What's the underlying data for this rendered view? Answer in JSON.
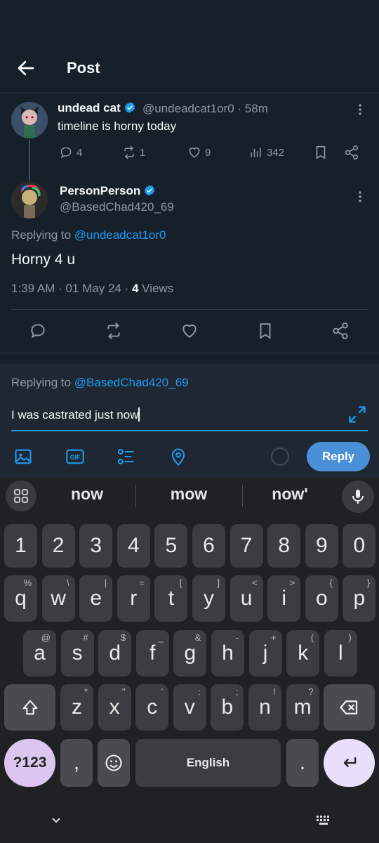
{
  "header": {
    "title": "Post"
  },
  "tweet1": {
    "name": "undead cat",
    "handle_time": "@undeadcat1or0 · 58m",
    "text": "timeline is horny today",
    "replies": "4",
    "reposts": "1",
    "likes": "9",
    "views": "342"
  },
  "tweet2": {
    "name": "PersonPerson",
    "handle": "@BasedChad420_69",
    "replying_prefix": "Replying to ",
    "replying_handle": "@undeadcat1or0",
    "text": "Horny 4 u",
    "meta_prefix": "1:39 AM · 01 May 24 · ",
    "views_count": "4",
    "views_label": " Views"
  },
  "composer": {
    "replying_prefix": "Replying to ",
    "replying_handle": "@BasedChad420_69",
    "input_value": "I was castrated just now",
    "reply_label": "Reply"
  },
  "keyboard": {
    "suggestions": [
      "now",
      "mow",
      "now'"
    ],
    "row1": [
      "1",
      "2",
      "3",
      "4",
      "5",
      "6",
      "7",
      "8",
      "9",
      "0"
    ],
    "row2": [
      {
        "k": "q",
        "s": "%"
      },
      {
        "k": "w",
        "s": "\\"
      },
      {
        "k": "e",
        "s": "|"
      },
      {
        "k": "r",
        "s": "="
      },
      {
        "k": "t",
        "s": "["
      },
      {
        "k": "y",
        "s": "]"
      },
      {
        "k": "u",
        "s": "<"
      },
      {
        "k": "i",
        "s": ">"
      },
      {
        "k": "o",
        "s": "{"
      },
      {
        "k": "p",
        "s": "}"
      }
    ],
    "row3": [
      {
        "k": "a",
        "s": "@"
      },
      {
        "k": "s",
        "s": "#"
      },
      {
        "k": "d",
        "s": "$"
      },
      {
        "k": "f",
        "s": "_"
      },
      {
        "k": "g",
        "s": "&"
      },
      {
        "k": "h",
        "s": "-"
      },
      {
        "k": "j",
        "s": "+"
      },
      {
        "k": "k",
        "s": "("
      },
      {
        "k": "l",
        "s": ")"
      }
    ],
    "row4": [
      {
        "k": "z",
        "s": "*"
      },
      {
        "k": "x",
        "s": "\""
      },
      {
        "k": "c",
        "s": "'"
      },
      {
        "k": "v",
        "s": ":"
      },
      {
        "k": "b",
        "s": ";"
      },
      {
        "k": "n",
        "s": "!"
      },
      {
        "k": "m",
        "s": "?"
      }
    ],
    "sym_label": "?123",
    "comma": ",",
    "space_label": "English",
    "period": "."
  }
}
